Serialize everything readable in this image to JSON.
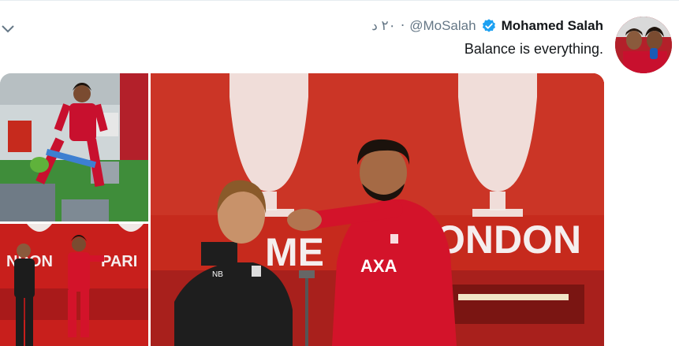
{
  "tweet": {
    "author_name": "Mohamed Salah",
    "handle": "@MoSalah",
    "timestamp": "٢٠ د",
    "separator": "·",
    "text": "Balance is everything.",
    "verified": true
  },
  "icons": {
    "menu": "chevron-down-icon",
    "verified": "verified-badge-icon"
  },
  "photos": [
    {
      "name": "training-photo-balance-board"
    },
    {
      "name": "training-photo-coach-and-player"
    },
    {
      "name": "training-photo-main-dance"
    }
  ],
  "banner_text": {
    "london": "ONDON",
    "paris": "PARI",
    "me": "ME",
    "ndon_small": "NDON"
  },
  "colors": {
    "accent": "#1da1f2",
    "liverpool_red": "#c8102e"
  }
}
